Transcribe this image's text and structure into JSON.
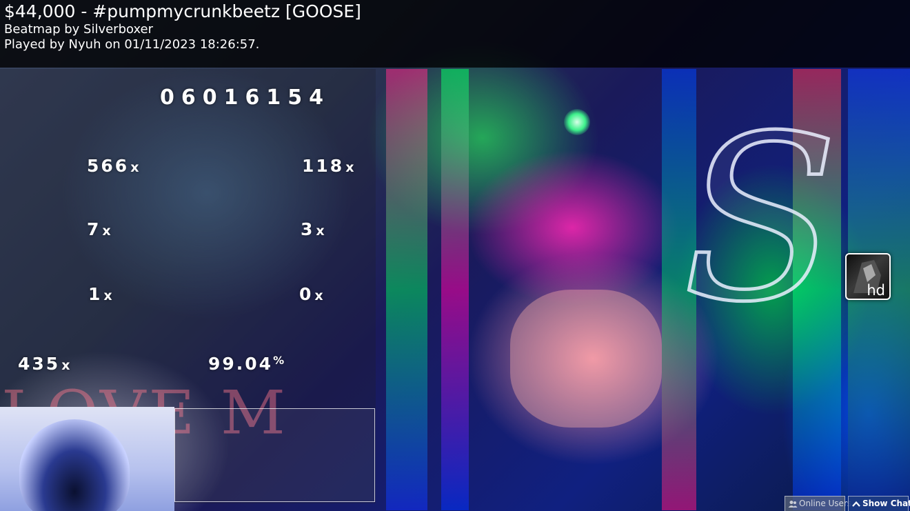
{
  "header": {
    "title": "$44,000 - #pumpmycrunkbeetz [GOOSE]",
    "beatmap_line": "Beatmap by Silverboxer",
    "played_line": "Played by Nyuh on 01/11/2023 18:26:57."
  },
  "results": {
    "score": "06016154",
    "count_300": "566",
    "count_geki": "118",
    "count_100": "7",
    "count_katu": "3",
    "count_50": "1",
    "count_miss": "0",
    "max_combo": "435",
    "accuracy": "99.04",
    "accuracy_unit": "%",
    "multiplier_symbol": "x"
  },
  "grade": {
    "letter": "S"
  },
  "mods": {
    "active": "hd"
  },
  "background_text": "LOVE M",
  "bottom_bar": {
    "online_users_label": "Online Users",
    "show_chat_label": "Show Chat"
  },
  "colors": {
    "header_bg": "#000000",
    "show_chat_bg": "#1e3c82"
  },
  "icons": [
    "users-icon",
    "chevron-up-icon"
  ]
}
